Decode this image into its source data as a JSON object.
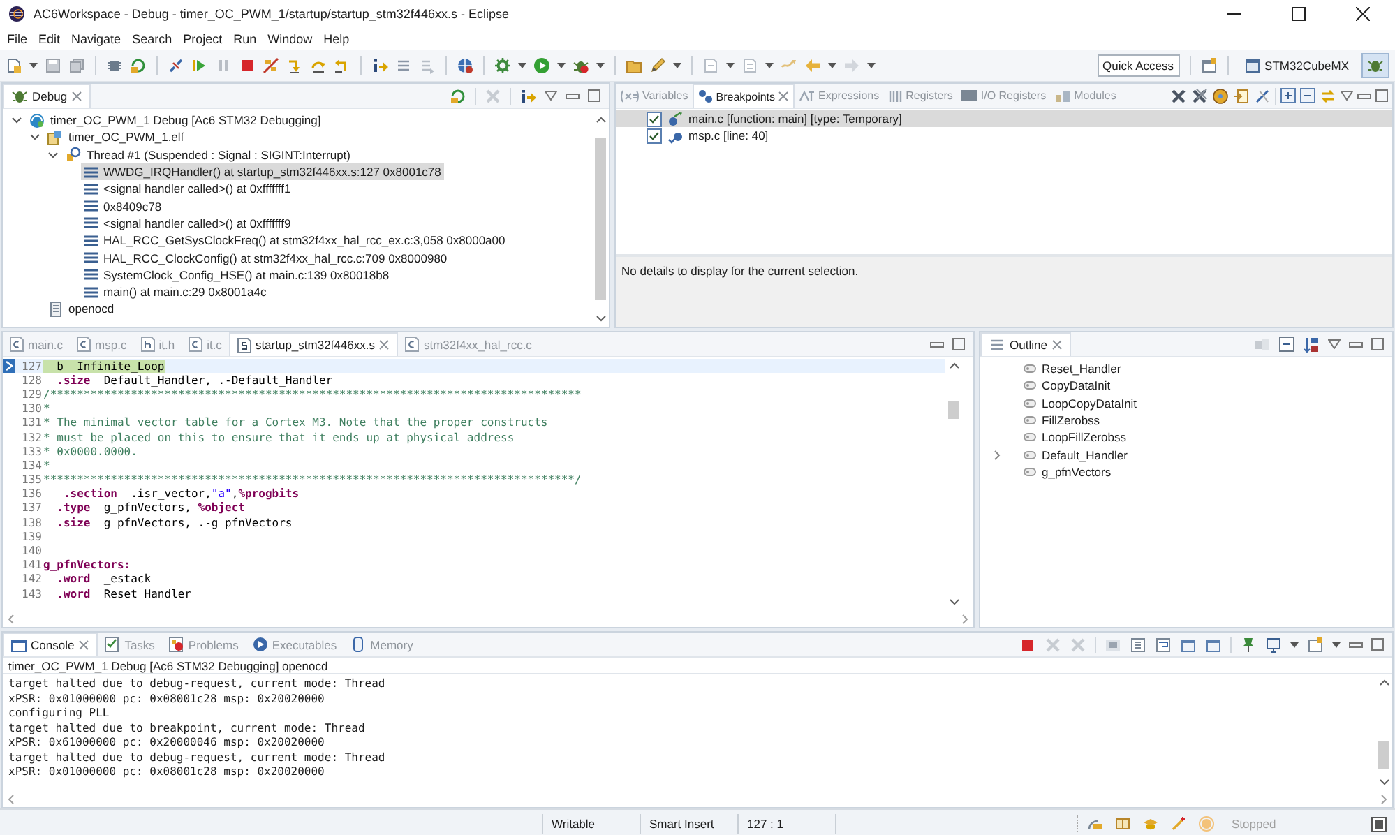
{
  "window": {
    "title": "AC6Workspace - Debug - timer_OC_PWM_1/startup/startup_stm32f446xx.s - Eclipse"
  },
  "menu": [
    "File",
    "Edit",
    "Navigate",
    "Search",
    "Project",
    "Run",
    "Window",
    "Help"
  ],
  "toolbar": {
    "quick_access": "Quick Access",
    "perspectives": [
      {
        "label": "STM32CubeMX",
        "selected": false
      },
      {
        "selected": true
      }
    ]
  },
  "debug_view": {
    "title": "Debug",
    "tree": [
      {
        "label": "timer_OC_PWM_1 Debug [Ac6 STM32 Debugging]",
        "kind": "launch",
        "expanded": true,
        "selected": false,
        "children": [
          {
            "label": "timer_OC_PWM_1.elf",
            "kind": "process",
            "expanded": true,
            "selected": false,
            "children": [
              {
                "label": "Thread #1 (Suspended : Signal : SIGINT:Interrupt)",
                "kind": "thread",
                "expanded": true,
                "selected": false,
                "children": [
                  {
                    "label": "WWDG_IRQHandler() at startup_stm32f446xx.s:127 0x8001c78",
                    "kind": "frame",
                    "selected": true
                  },
                  {
                    "label": "<signal handler called>() at 0xfffffff1",
                    "kind": "frame",
                    "selected": false
                  },
                  {
                    "label": "0x8409c78",
                    "kind": "frame",
                    "selected": false
                  },
                  {
                    "label": "<signal handler called>() at 0xfffffff9",
                    "kind": "frame",
                    "selected": false
                  },
                  {
                    "label": "HAL_RCC_GetSysClockFreq() at stm32f4xx_hal_rcc_ex.c:3,058 0x8000a00",
                    "kind": "frame",
                    "selected": false
                  },
                  {
                    "label": "HAL_RCC_ClockConfig() at stm32f4xx_hal_rcc.c:709 0x8000980",
                    "kind": "frame",
                    "selected": false
                  },
                  {
                    "label": "SystemClock_Config_HSE() at main.c:139 0x80018b8",
                    "kind": "frame",
                    "selected": false
                  },
                  {
                    "label": "main() at main.c:29 0x8001a4c",
                    "kind": "frame",
                    "selected": false
                  }
                ]
              }
            ]
          },
          {
            "label": "openocd",
            "kind": "terminal",
            "selected": false
          }
        ]
      }
    ]
  },
  "breakpoints_view": {
    "tabs": [
      {
        "label": "Variables",
        "selected": false
      },
      {
        "label": "Breakpoints",
        "selected": true
      },
      {
        "label": "Expressions",
        "selected": false
      },
      {
        "label": "Registers",
        "selected": false
      },
      {
        "label": "I/O Registers",
        "selected": false
      },
      {
        "label": "Modules",
        "selected": false
      }
    ],
    "breakpoints": [
      {
        "label": "main.c [function: main] [type: Temporary]",
        "kind": "temporary",
        "checked": true,
        "selected": true
      },
      {
        "label": "msp.c [line: 40]",
        "kind": "line",
        "checked": true,
        "selected": false
      }
    ],
    "details": "No details to display for the current selection."
  },
  "editor": {
    "tabs": [
      {
        "label": "main.c",
        "selected": false
      },
      {
        "label": "msp.c",
        "selected": false
      },
      {
        "label": "it.h",
        "selected": false
      },
      {
        "label": "it.c",
        "selected": false
      },
      {
        "label": "startup_stm32f446xx.s",
        "selected": true
      },
      {
        "label": "stm32f4xx_hal_rcc.c",
        "selected": false
      }
    ],
    "lines": [
      {
        "number": "127",
        "current": true,
        "segments": [
          {
            "kind": "plain",
            "text": "  b  Infinite_Loop"
          }
        ]
      },
      {
        "number": "128",
        "current": false,
        "segments": [
          {
            "kind": "keyword",
            "text": "  .size"
          },
          {
            "kind": "plain",
            "text": "  Default_Handler, .-Default_Handler"
          }
        ]
      },
      {
        "number": "129",
        "current": false,
        "segments": [
          {
            "kind": "comment",
            "text": "/*******************************************************************************"
          }
        ]
      },
      {
        "number": "130",
        "current": false,
        "segments": [
          {
            "kind": "comment",
            "text": "*"
          }
        ]
      },
      {
        "number": "131",
        "current": false,
        "segments": [
          {
            "kind": "comment",
            "text": "* The minimal vector table for a Cortex M3. Note that the proper constructs"
          }
        ]
      },
      {
        "number": "132",
        "current": false,
        "segments": [
          {
            "kind": "comment",
            "text": "* must be placed on this to ensure that it ends up at physical address"
          }
        ]
      },
      {
        "number": "133",
        "current": false,
        "segments": [
          {
            "kind": "comment",
            "text": "* 0x0000.0000."
          }
        ]
      },
      {
        "number": "134",
        "current": false,
        "segments": [
          {
            "kind": "comment",
            "text": "*"
          }
        ]
      },
      {
        "number": "135",
        "current": false,
        "segments": [
          {
            "kind": "comment",
            "text": "*******************************************************************************/"
          }
        ]
      },
      {
        "number": "136",
        "current": false,
        "segments": [
          {
            "kind": "keyword",
            "text": "   .section"
          },
          {
            "kind": "plain",
            "text": "  .isr_vector,"
          },
          {
            "kind": "string",
            "text": "\"a\""
          },
          {
            "kind": "plain",
            "text": ","
          },
          {
            "kind": "keyword",
            "text": "%progbits"
          }
        ]
      },
      {
        "number": "137",
        "current": false,
        "segments": [
          {
            "kind": "keyword",
            "text": "  .type"
          },
          {
            "kind": "plain",
            "text": "  g_pfnVectors, "
          },
          {
            "kind": "keyword",
            "text": "%object"
          }
        ]
      },
      {
        "number": "138",
        "current": false,
        "segments": [
          {
            "kind": "keyword",
            "text": "  .size"
          },
          {
            "kind": "plain",
            "text": "  g_pfnVectors, .-g_pfnVectors"
          }
        ]
      },
      {
        "number": "139",
        "current": false
      },
      {
        "number": "140",
        "current": false
      },
      {
        "number": "141",
        "current": false,
        "segments": [
          {
            "kind": "keyword",
            "text": "g_pfnVectors:"
          }
        ]
      },
      {
        "number": "142",
        "current": false,
        "segments": [
          {
            "kind": "keyword",
            "text": "  .word"
          },
          {
            "kind": "plain",
            "text": "  _estack"
          }
        ]
      },
      {
        "number": "143",
        "current": false,
        "segments": [
          {
            "kind": "keyword",
            "text": "  .word"
          },
          {
            "kind": "plain",
            "text": "  Reset_Handler"
          }
        ]
      }
    ]
  },
  "outline": {
    "title": "Outline",
    "items": [
      {
        "label": "Reset_Handler"
      },
      {
        "label": "CopyDataInit"
      },
      {
        "label": "LoopCopyDataInit"
      },
      {
        "label": "FillZerobss"
      },
      {
        "label": "LoopFillZerobss"
      },
      {
        "label": "Default_Handler",
        "expanded": false
      },
      {
        "label": "g_pfnVectors"
      }
    ]
  },
  "console": {
    "tabs": [
      {
        "label": "Console",
        "selected": true
      },
      {
        "label": "Tasks",
        "selected": false
      },
      {
        "label": "Problems",
        "selected": false
      },
      {
        "label": "Executables",
        "selected": false
      },
      {
        "label": "Memory",
        "selected": false
      }
    ],
    "header": "timer_OC_PWM_1 Debug [Ac6 STM32 Debugging] openocd",
    "lines": [
      "target halted due to debug-request, current mode: Thread",
      "xPSR: 0x01000000 pc: 0x08001c28 msp: 0x20020000",
      "configuring PLL",
      "target halted due to breakpoint, current mode: Thread",
      "xPSR: 0x61000000 pc: 0x20000046 msp: 0x20020000",
      "target halted due to debug-request, current mode: Thread",
      "xPSR: 0x01000000 pc: 0x08001c28 msp: 0x20020000"
    ]
  },
  "status_bar": {
    "fields": [
      "Writable",
      "Smart Insert",
      "127 : 1"
    ],
    "state": "Stopped"
  }
}
